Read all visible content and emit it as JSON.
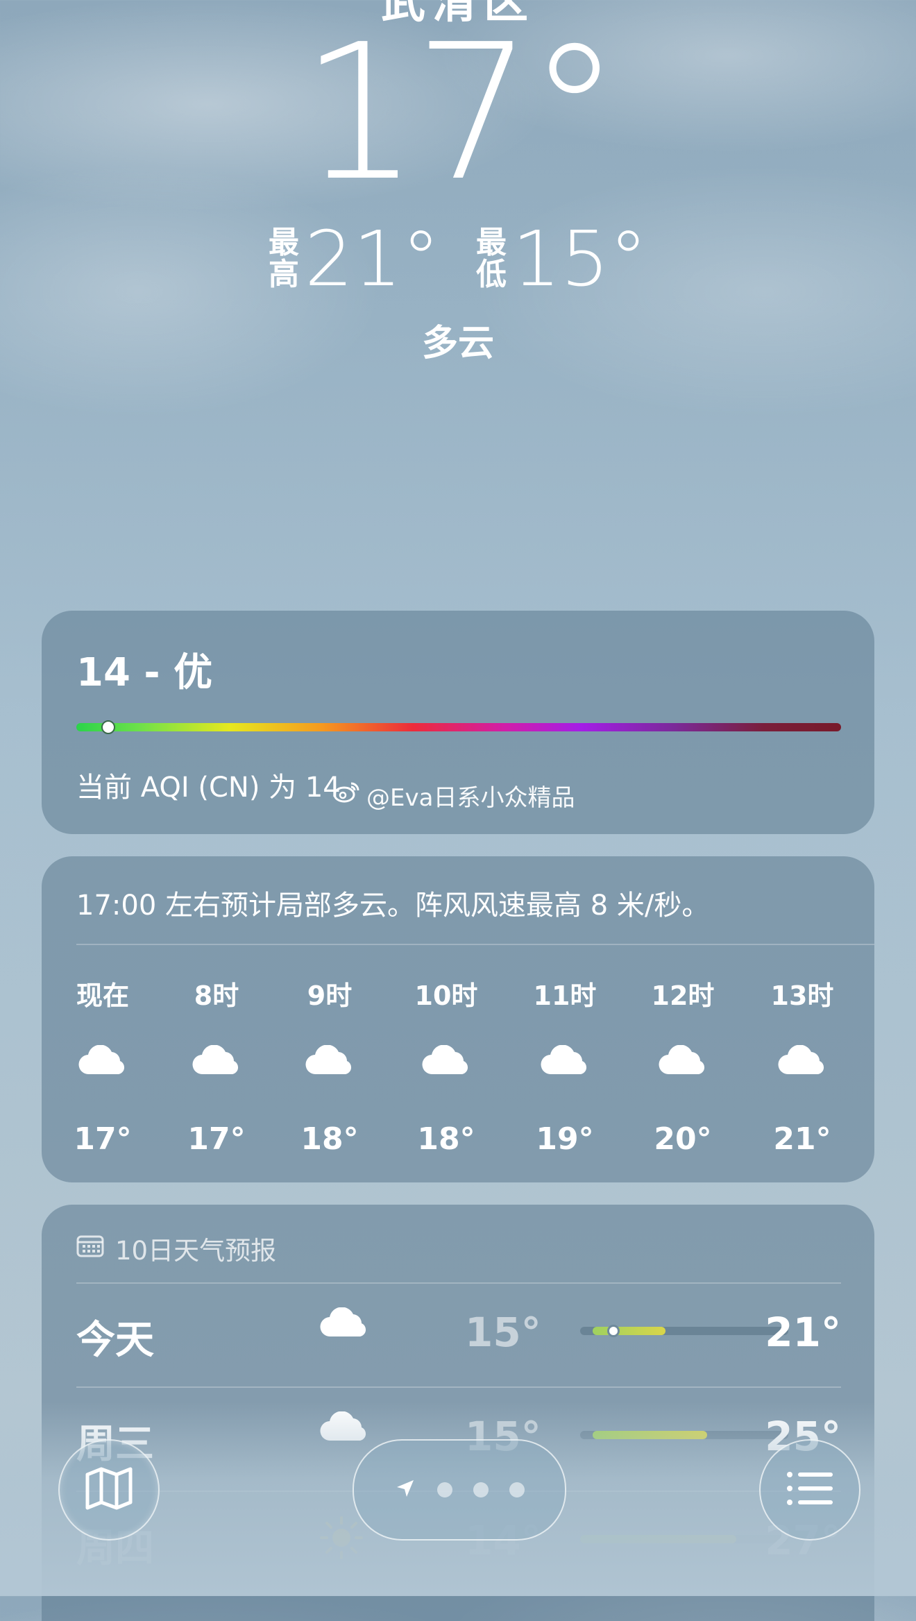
{
  "header": {
    "city": "武清区",
    "current_temp": "17°",
    "high_label_1": "最",
    "high_label_2": "高",
    "high_temp": "21°",
    "low_label_1": "最",
    "low_label_2": "低",
    "low_temp": "15°",
    "condition": "多云"
  },
  "aqi": {
    "title": "14 - 优",
    "value": 14,
    "description": "当前 AQI (CN) 为 14"
  },
  "watermark": {
    "text": "@Eva日系小众精品",
    "icon": "weibo-icon"
  },
  "hourly": {
    "summary": "17:00 左右预计局部多云。阵风风速最高 8 米/秒。",
    "items": [
      {
        "label": "现在",
        "icon": "cloud-icon",
        "temp": "17°"
      },
      {
        "label": "8时",
        "icon": "cloud-icon",
        "temp": "17°"
      },
      {
        "label": "9时",
        "icon": "cloud-icon",
        "temp": "18°"
      },
      {
        "label": "10时",
        "icon": "cloud-icon",
        "temp": "18°"
      },
      {
        "label": "11时",
        "icon": "cloud-icon",
        "temp": "19°"
      },
      {
        "label": "12时",
        "icon": "cloud-icon",
        "temp": "20°"
      },
      {
        "label": "13时",
        "icon": "cloud-icon",
        "temp": "21°"
      }
    ]
  },
  "daily": {
    "title": "10日天气预报",
    "icon": "calendar-icon",
    "rows": [
      {
        "day": "今天",
        "icon": "cloud-icon",
        "low": "15°",
        "high": "21°",
        "range_start": 0.06,
        "range_end": 0.41,
        "current": 0.16
      },
      {
        "day": "周三",
        "icon": "cloud-icon",
        "low": "15°",
        "high": "25°",
        "range_start": 0.06,
        "range_end": 0.61
      },
      {
        "day": "周四",
        "icon": "sun-icon",
        "low": "14°",
        "high": "27°",
        "range_start": 0.0,
        "range_end": 0.75
      }
    ]
  },
  "nav": {
    "map_icon": "map-icon",
    "location_icon": "location-arrow-icon",
    "list_icon": "list-icon"
  },
  "colors": {
    "aqi_good": "#2bd34a",
    "range_fill_start": "#9fd160",
    "range_fill_end": "#d9d54a"
  }
}
